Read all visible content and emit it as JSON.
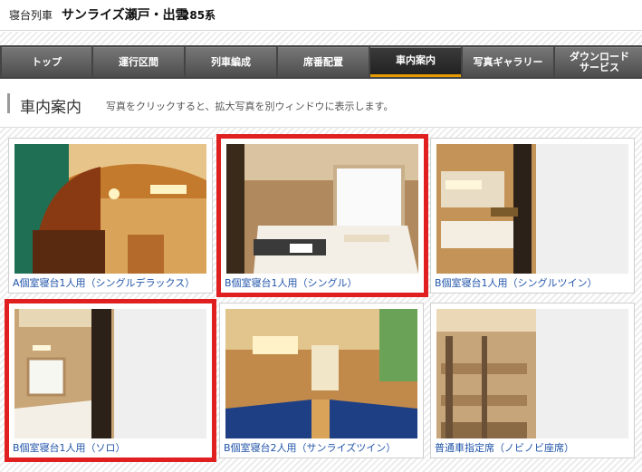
{
  "header": {
    "category": "寝台列車",
    "train_name": "サンライズ瀬戸・出雲",
    "series": "285系"
  },
  "nav": [
    {
      "label": "トップ",
      "active": false
    },
    {
      "label": "運行区間",
      "active": false
    },
    {
      "label": "列車編成",
      "active": false
    },
    {
      "label": "席番配置",
      "active": false
    },
    {
      "label": "車内案内",
      "active": true
    },
    {
      "label": "写真ギャラリー",
      "active": false
    },
    {
      "label": "ダウンロード\nサービス",
      "active": false
    }
  ],
  "page": {
    "title": "車内案内",
    "description": "写真をクリックすると、拡大写真を別ウィンドウに表示します。"
  },
  "gallery": [
    {
      "caption": "A個室寝台1人用（シングルデラックス）",
      "highlighted": false
    },
    {
      "caption": "B個室寝台1人用（シングル）",
      "highlighted": true
    },
    {
      "caption": "B個室寝台1人用（シングルツイン）",
      "highlighted": false
    },
    {
      "caption": "B個室寝台1人用（ソロ）",
      "highlighted": true
    },
    {
      "caption": "B個室寝台2人用（サンライズツイン）",
      "highlighted": false
    },
    {
      "caption": "普通車指定席（ノビノビ座席）",
      "highlighted": false
    }
  ]
}
